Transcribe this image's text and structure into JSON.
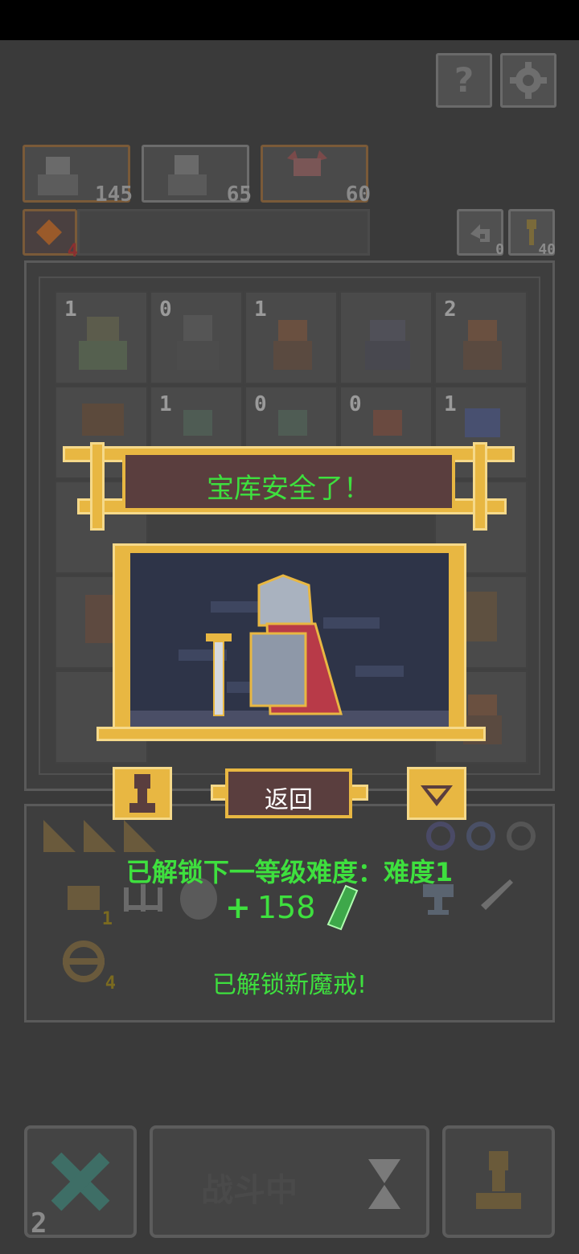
{
  "top_right": {
    "help_label": "?"
  },
  "heroes": [
    {
      "count": "145"
    },
    {
      "count": "65"
    },
    {
      "count": "60"
    }
  ],
  "status_row": {
    "potion_count": "4",
    "undo_count": "0",
    "key_count": "40"
  },
  "grid": {
    "numbers": [
      "1",
      "0",
      "1",
      "",
      "2",
      "",
      "1",
      "0",
      "0",
      "1"
    ]
  },
  "dialog": {
    "title": "宝库安全了！",
    "back_label": "返回"
  },
  "rewards": {
    "unlock_text": "已解锁下一等级难度：难度1",
    "gem_prefix": "+",
    "gem_amount": "158",
    "ring_text": "已解锁新魔戒!"
  },
  "inventory": {
    "item_count": "1",
    "ring_count": "4"
  },
  "bottom": {
    "battle_label": "战斗中",
    "page_number": "2"
  },
  "colors": {
    "accent_green": "#3ee03e",
    "gold": "#e8b742",
    "dialog_brown": "#5a3e3e"
  }
}
